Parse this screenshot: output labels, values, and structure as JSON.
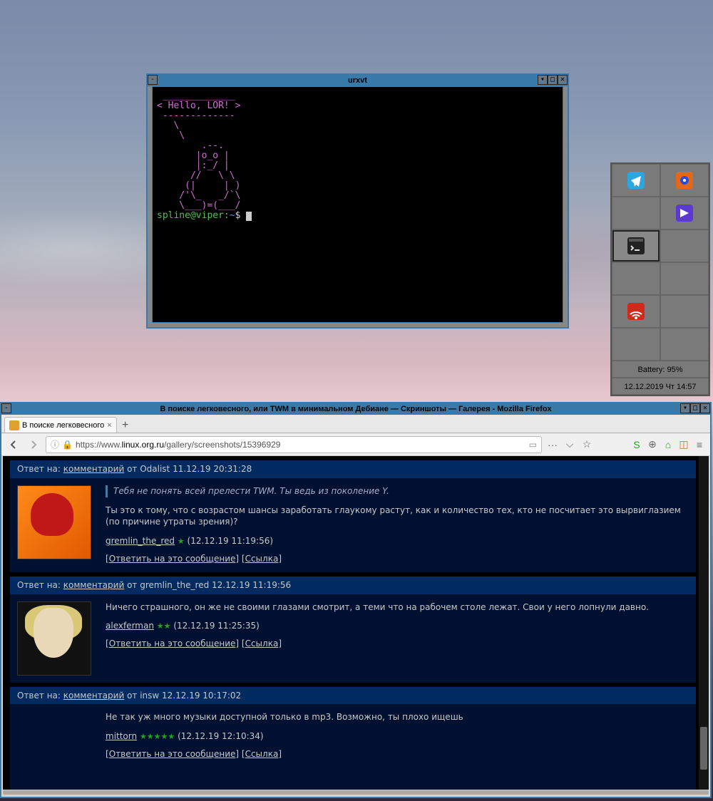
{
  "urxvt": {
    "title": "urxvt",
    "cowsay": " _____________\n< Hello, LOR! >\n -------------\n   \\\n    \\\n        .--.\n       |o_o |\n       |:_/ |\n      //   \\ \\\n     (|     | )\n    /'\\_   _/`\\\n    \\___)=(___/",
    "prompt_user": "spline@viper",
    "prompt_sep": ":",
    "prompt_path": "~",
    "prompt_char": "$"
  },
  "panel": {
    "battery": "Battery: 95%",
    "clock": "12.12.2019 Чт 14:57",
    "icons": {
      "telegram": "telegram",
      "audacity": "audacity",
      "video": "video",
      "terminal": "terminal",
      "network": "network"
    }
  },
  "firefox": {
    "wintitle": "В поиске легковесного, или TWM в минимальном Дебиане — Скриншоты — Галерея - Mozilla Firefox",
    "tab_label": "В поиске легковесного",
    "tab_close": "×",
    "newtab": "+",
    "nav": {
      "back": "←",
      "fwd": "→"
    },
    "url_prefix": "https://www.",
    "url_domain": "linux.org.ru",
    "url_path": "/gallery/screenshots/15396929",
    "tb_icons": {
      "info": "ⓘ",
      "lock": "🔒",
      "reader": "▭",
      "dots": "···",
      "pocket": "⌵",
      "star": "☆",
      "hamburger": "≡"
    },
    "ext": {
      "s": "S",
      "globe": "⊕",
      "tag": "⌂",
      "box": "◫"
    },
    "comments": [
      {
        "reply_to_prefix": "Ответ на: ",
        "reply_to_link": "комментарий",
        "reply_to_suffix": " от Odalist 11.12.19 20:31:28",
        "avatar": "av1",
        "quote": "Тебя не понять всей прелести TWM. Ты ведь из поколение Y.",
        "text": "Ты это к тому, что с возрастом шансы заработать глаукому растут, как и количество тех, кто не посчитает это вырвиглазием (по причине утраты зрения)?",
        "author": "gremlin_the_red",
        "stars": "★",
        "date": "(12.12.19 11:19:56)",
        "act_reply": "Ответить на это сообщение",
        "act_link": "Ссылка"
      },
      {
        "reply_to_prefix": "Ответ на: ",
        "reply_to_link": "комментарий",
        "reply_to_suffix": " от gremlin_the_red 12.12.19 11:19:56",
        "avatar": "av2",
        "quote": "",
        "text": "Ничего страшного, он же не своими глазами смотрит, а теми что на рабочем столе лежат. Свои у него лопнули давно.",
        "author": "alexferman",
        "stars": "★★",
        "date": "(12.12.19 11:25:35)",
        "act_reply": "Ответить на это сообщение",
        "act_link": "Ссылка"
      },
      {
        "reply_to_prefix": "Ответ на: ",
        "reply_to_link": "комментарий",
        "reply_to_suffix": " от insw 12.12.19 10:17:02",
        "avatar": "",
        "quote": "",
        "text": "Не так уж много музыки доступной только в mp3. Возможно, ты плохо ищешь",
        "author": "mittorn",
        "stars": "★★★★★",
        "date": "(12.12.19 12:10:34)",
        "act_reply": "Ответить на это сообщение",
        "act_link": "Ссылка"
      }
    ]
  }
}
